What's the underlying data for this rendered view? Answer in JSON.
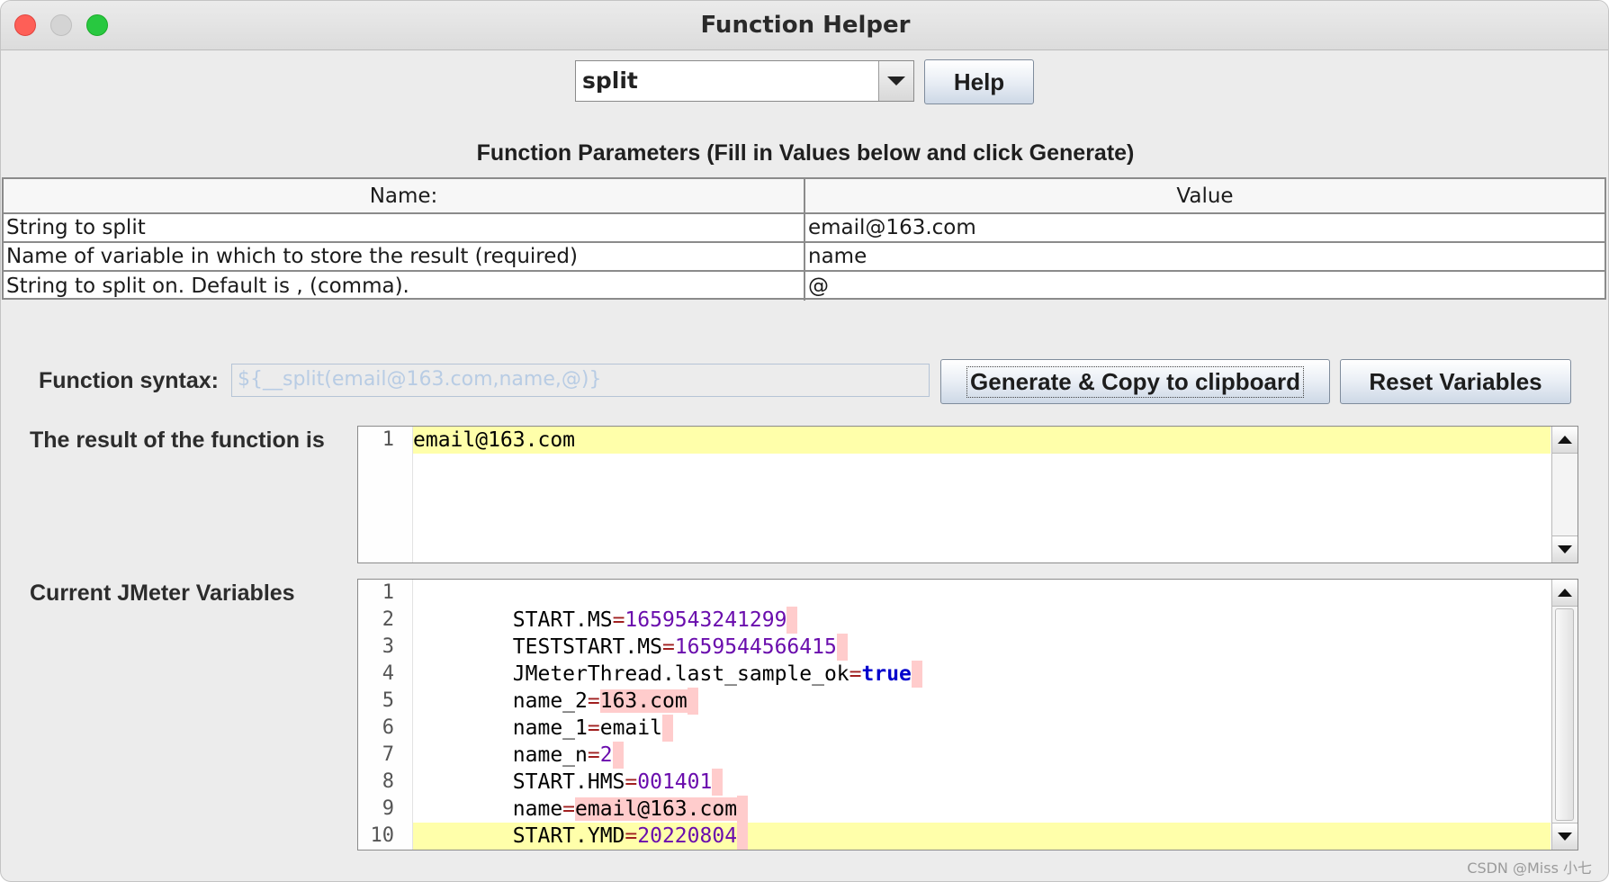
{
  "window": {
    "title": "Function Helper"
  },
  "function_select": {
    "value": "split"
  },
  "help_button": "Help",
  "params": {
    "title": "Function Parameters (Fill in Values below and click Generate)",
    "headers": {
      "name": "Name:",
      "value": "Value"
    },
    "rows": [
      {
        "name": "String to split",
        "value": "email@163.com"
      },
      {
        "name": "Name of variable in which to store the result (required)",
        "value": "name"
      },
      {
        "name": "String to split on. Default is , (comma).",
        "value": "@"
      }
    ]
  },
  "syntax": {
    "label": "Function syntax:",
    "value": "${__split(email@163.com,name,@)}"
  },
  "buttons": {
    "generate": "Generate & Copy to clipboard",
    "reset": "Reset Variables"
  },
  "result": {
    "label": "The result of the function is",
    "lines": [
      {
        "num": "1",
        "text": "email@163.com"
      }
    ]
  },
  "variables": {
    "label": "Current JMeter Variables",
    "lines": [
      {
        "num": "1",
        "key": "START.MS",
        "eq": "=",
        "value": "1659543241299"
      },
      {
        "num": "2",
        "key": "TESTSTART.MS",
        "eq": "=",
        "value": "1659544566415"
      },
      {
        "num": "3",
        "key": "JMeterThread.last_sample_ok",
        "eq": "=",
        "value": "true"
      },
      {
        "num": "4",
        "key": "name_2",
        "eq": "=",
        "value": "163.com"
      },
      {
        "num": "5",
        "key": "name_1",
        "eq": "=",
        "value": "email"
      },
      {
        "num": "6",
        "key": "name_n",
        "eq": "=",
        "value": "2"
      },
      {
        "num": "7",
        "key": "START.HMS",
        "eq": "=",
        "value": "001401"
      },
      {
        "num": "8",
        "key": "name",
        "eq": "=",
        "value": "email@163.com"
      },
      {
        "num": "9",
        "key": "START.YMD",
        "eq": "=",
        "value": "20220804"
      },
      {
        "num": "10",
        "key": "",
        "eq": "",
        "value": ""
      }
    ]
  },
  "watermark": "CSDN @Miss 小七",
  "colors": {
    "current_line": "#ffffaa",
    "highlight": "#ffcccc",
    "number": "#6a0dad",
    "keyword": "#0000cc"
  }
}
